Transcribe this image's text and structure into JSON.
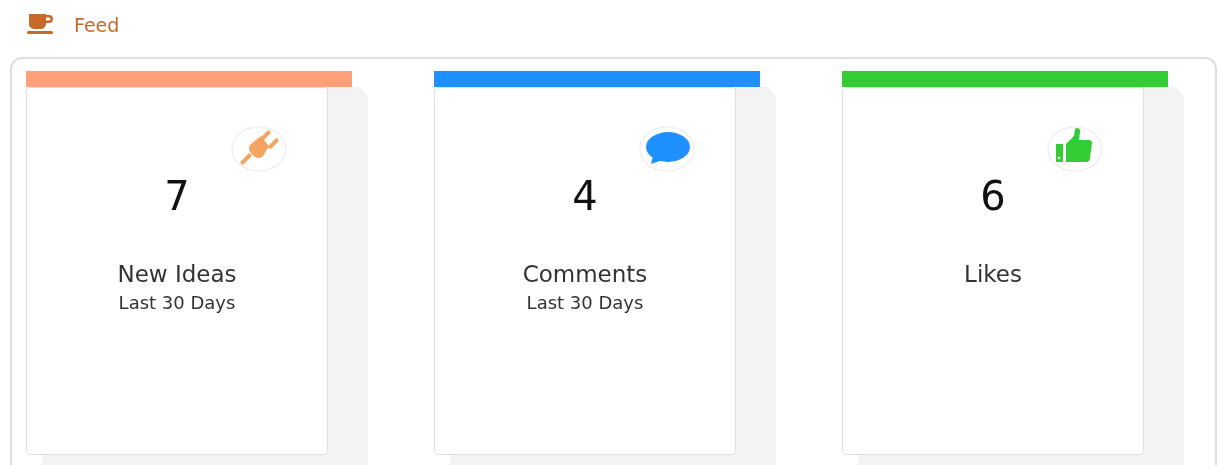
{
  "header": {
    "title": "Feed"
  },
  "cards": [
    {
      "kind": "plug",
      "color": "#ffa07a",
      "value": "7",
      "title": "New Ideas",
      "subtitle": "Last 30 Days"
    },
    {
      "kind": "speech",
      "color": "#1e90ff",
      "value": "4",
      "title": "Comments",
      "subtitle": "Last 30 Days"
    },
    {
      "kind": "thumb",
      "color": "#32cd32",
      "value": "6",
      "title": "Likes"
    }
  ]
}
